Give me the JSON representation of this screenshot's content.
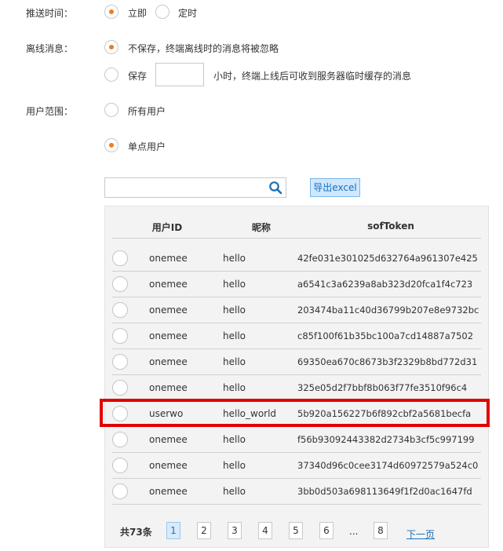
{
  "push_time": {
    "label": "推送时间：",
    "options": [
      {
        "label": "立即",
        "checked": true
      },
      {
        "label": "定时",
        "checked": false
      }
    ]
  },
  "offline_msg": {
    "label": "离线消息：",
    "options": [
      {
        "label": "不保存，终端离线时的消息将被忽略",
        "checked": true
      },
      {
        "label": "保存",
        "checked": false
      }
    ],
    "hours_value": "",
    "hours_suffix": "小时，终端上线后可收到服务器临时缓存的消息"
  },
  "user_scope": {
    "label": "用户范围：",
    "options": [
      {
        "label": "所有用户",
        "checked": false
      },
      {
        "label": "单点用户",
        "checked": true
      }
    ]
  },
  "search": {
    "placeholder": "",
    "value": "",
    "icon": "search-icon"
  },
  "export_button": "导出excel",
  "table": {
    "columns": [
      "用户ID",
      "昵称",
      "sofToken"
    ],
    "rows": [
      {
        "id": "onemee",
        "nick": "hello",
        "token": "42fe031e301025d632764a961307e425"
      },
      {
        "id": "onemee",
        "nick": "hello",
        "token": "a6541c3a6239a8ab323d20fca1f4c723"
      },
      {
        "id": "onemee",
        "nick": "hello",
        "token": "203474ba11c40d36799b207e8e9732bc"
      },
      {
        "id": "onemee",
        "nick": "hello",
        "token": "c85f100f61b35bc100a7cd14887a7502"
      },
      {
        "id": "onemee",
        "nick": "hello",
        "token": "69350ea670c8673b3f2329b8bd772d31"
      },
      {
        "id": "onemee",
        "nick": "hello",
        "token": "325e05d2f7bbf8b063f77fe3510f96c4"
      },
      {
        "id": "userwo",
        "nick": "hello_world",
        "token": "5b920a156227b6f892cbf2a5681becfa"
      },
      {
        "id": "onemee",
        "nick": "hello",
        "token": "f56b93092443382d2734b3cf5c997199"
      },
      {
        "id": "onemee",
        "nick": "hello",
        "token": "37340d96c0cee3174d60972579a524c0"
      },
      {
        "id": "onemee",
        "nick": "hello",
        "token": "3bb0d503a698113649f1f2d0ac1647fd"
      }
    ],
    "highlighted_row_index": 6,
    "highlight_color": "#e10000"
  },
  "pagination": {
    "total": "共73条",
    "pages": [
      "1",
      "2",
      "3",
      "4",
      "5",
      "6"
    ],
    "ellipsis": "...",
    "last": "8",
    "current": "1",
    "next": "下一页"
  },
  "colors": {
    "accent": "#f07c1c",
    "link": "#1a6fb5"
  }
}
